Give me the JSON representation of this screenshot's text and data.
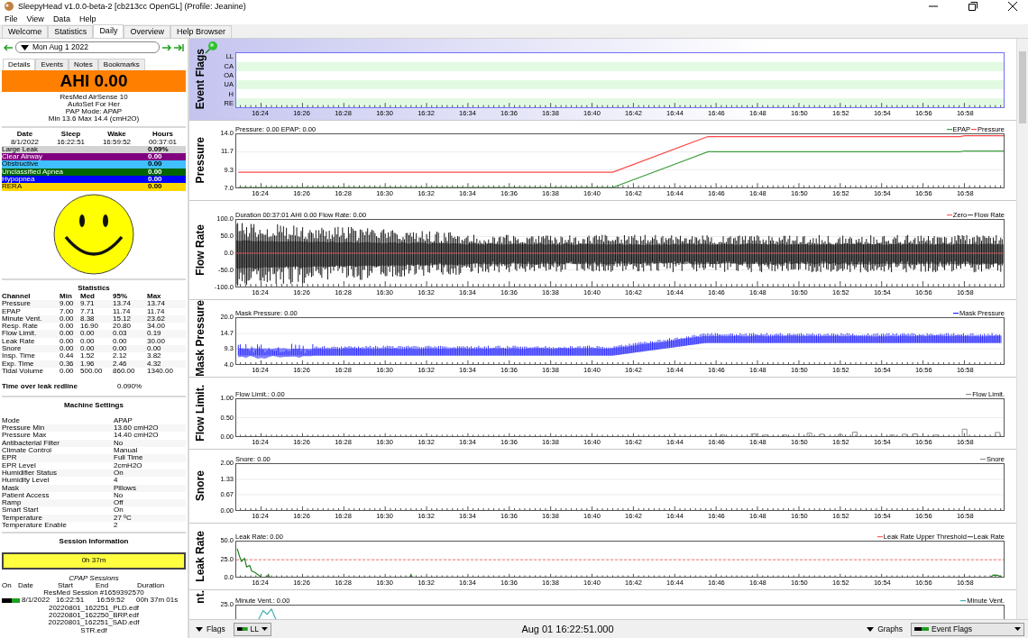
{
  "window": {
    "title": "SleepyHead v1.0.0-beta-2 [cb213cc OpenGL] (Profile: Jeanine)"
  },
  "menu": [
    "File",
    "View",
    "Data",
    "Help"
  ],
  "tabs": [
    {
      "label": "Welcome",
      "selected": false
    },
    {
      "label": "Statistics",
      "selected": false
    },
    {
      "label": "Daily",
      "selected": true
    },
    {
      "label": "Overview",
      "selected": false
    },
    {
      "label": "Help Browser",
      "selected": false
    }
  ],
  "date_nav": {
    "date": "Mon Aug 1 2022"
  },
  "detail_tabs": [
    {
      "label": "Details",
      "selected": true
    },
    {
      "label": "Events",
      "selected": false
    },
    {
      "label": "Notes",
      "selected": false
    },
    {
      "label": "Bookmarks",
      "selected": false
    }
  ],
  "ahi": "AHI 0.00",
  "machine": [
    "ResMed AirSense 10",
    "AutoSet For Her",
    "PAP Mode: APAP",
    "Min 13.6 Max 14.4 (cmH2O)"
  ],
  "times": {
    "headers": [
      "Date",
      "Sleep",
      "Wake",
      "Hours"
    ],
    "values": [
      "8/1/2022",
      "16:22:51",
      "16:59:52",
      "00:37:01"
    ]
  },
  "event_counts": [
    {
      "name": "Large Leak",
      "value": "0.09%",
      "color": "#d3d3d3"
    },
    {
      "name": "Clear Airway",
      "value": "0.00",
      "color": "#800080"
    },
    {
      "name": "Obstructive",
      "value": "0.00",
      "color": "#40c0ff"
    },
    {
      "name": "Unclassified Apnea",
      "value": "0.00",
      "color": "#006400"
    },
    {
      "name": "Hypopnea",
      "value": "0.00",
      "color": "#0000ff"
    },
    {
      "name": "RERA",
      "value": "0.00",
      "color": "#ffd700"
    }
  ],
  "statistics": {
    "title": "Statistics",
    "columns": [
      "Channel",
      "Min",
      "Med",
      "95%",
      "Max"
    ],
    "rows": [
      [
        "Pressure",
        "9.00",
        "9.71",
        "13.74",
        "13.74"
      ],
      [
        "EPAP",
        "7.00",
        "7.71",
        "11.74",
        "11.74"
      ],
      [
        "Minute Vent.",
        "0.00",
        "8.38",
        "15.12",
        "23.62"
      ],
      [
        "Resp. Rate",
        "0.00",
        "16.90",
        "20.80",
        "34.00"
      ],
      [
        "Flow Limit.",
        "0.00",
        "0.00",
        "0.03",
        "0.19"
      ],
      [
        "Leak Rate",
        "0.00",
        "0.00",
        "0.00",
        "30.00"
      ],
      [
        "Snore",
        "0.00",
        "0.00",
        "0.00",
        "0.00"
      ],
      [
        "Insp. Time",
        "0.44",
        "1.52",
        "2.12",
        "3.82"
      ],
      [
        "Exp. Time",
        "0.36",
        "1.96",
        "2.46",
        "4.32"
      ],
      [
        "Tidal Volume",
        "0.00",
        "500.00",
        "860.00",
        "1340.00"
      ]
    ]
  },
  "leak_redline": {
    "label": "Time over leak redline",
    "value": "0.090%"
  },
  "machine_settings": {
    "title": "Machine Settings",
    "rows": [
      [
        "Mode",
        "APAP"
      ],
      [
        "Pressure Min",
        "13.60 cmH2O"
      ],
      [
        "Pressure Max",
        "14.40 cmH2O"
      ],
      [
        "Antibacterial Filter",
        "No"
      ],
      [
        "Climate Control",
        "Manual"
      ],
      [
        "EPR",
        "Full Time"
      ],
      [
        "EPR Level",
        "2cmH2O"
      ],
      [
        "Humidifier Status",
        "On"
      ],
      [
        "Humidity Level",
        "4"
      ],
      [
        "Mask",
        "Pillows"
      ],
      [
        "Patient Access",
        "No"
      ],
      [
        "Ramp",
        "Off"
      ],
      [
        "Smart Start",
        "On"
      ],
      [
        "Temperature",
        "27 ºC"
      ],
      [
        "Temperature Enable",
        "2"
      ]
    ]
  },
  "session_info": {
    "title": "Session Information",
    "duration": "0h 37m"
  },
  "cpap_sessions": {
    "title": "CPAP Sessions",
    "columns": [
      "On",
      "Date",
      "Start",
      "End",
      "Duration"
    ],
    "session": "ResMed Session #1659392570",
    "row": [
      "8/1/2022",
      "16:22:51",
      "16:59:52",
      "00h 37m 01s"
    ],
    "files": [
      "20220801_162251_PLD.edf",
      "20220801_162250_BRP.edf",
      "20220801_162251_SAD.edf",
      "STR.edf"
    ]
  },
  "graphs": [
    {
      "kind": "flags",
      "title": "Event Flags",
      "rows": [
        "LL",
        "CA",
        "OA",
        "UA",
        "H",
        "RE"
      ],
      "x_labels": [
        "16:24",
        "16:26",
        "16:28",
        "16:30",
        "16:32",
        "16:34",
        "16:36",
        "16:38",
        "16:40",
        "16:42",
        "16:44",
        "16:46",
        "16:48",
        "16:50",
        "16:52",
        "16:54",
        "16:56",
        "16:58"
      ]
    },
    {
      "kind": "line",
      "title": "Pressure",
      "readout": "Pressure: 0.00 EPAP: 0.00",
      "chart_data": {
        "type": "line",
        "x": [
          982.9,
          1001.0,
          1005.6,
          1017.8,
          1018.0,
          1019.9
        ],
        "series": [
          {
            "name": "EPAP",
            "color": "#40a040",
            "values": [
              7.0,
              7.0,
              11.7,
              11.7,
              11.8,
              11.8
            ]
          },
          {
            "name": "Pressure",
            "color": "#ff4848",
            "values": [
              9.0,
              9.0,
              13.7,
              13.7,
              13.8,
              13.8
            ]
          }
        ],
        "legend": "top-right",
        "xlim": [
          982.8,
          1019.9
        ],
        "ylim": [
          7,
          14
        ],
        "xticks": [
          {
            "value": 984,
            "label": "16:24"
          },
          {
            "value": 986,
            "label": "16:26"
          },
          {
            "value": 988,
            "label": "16:28"
          },
          {
            "value": 990,
            "label": "16:30"
          },
          {
            "value": 992,
            "label": "16:32"
          },
          {
            "value": 994,
            "label": "16:34"
          },
          {
            "value": 996,
            "label": "16:36"
          },
          {
            "value": 998,
            "label": "16:38"
          },
          {
            "value": 1000,
            "label": "16:40"
          },
          {
            "value": 1002,
            "label": "16:42"
          },
          {
            "value": 1004,
            "label": "16:44"
          },
          {
            "value": 1006,
            "label": "16:46"
          },
          {
            "value": 1008,
            "label": "16:48"
          },
          {
            "value": 1010,
            "label": "16:50"
          },
          {
            "value": 1012,
            "label": "16:52"
          },
          {
            "value": 1014,
            "label": "16:54"
          },
          {
            "value": 1016,
            "label": "16:56"
          },
          {
            "value": 1018,
            "label": "16:58"
          }
        ],
        "yticks": [
          {
            "value": 14,
            "label": "14.0"
          },
          {
            "value": 11.67,
            "label": "11.7"
          },
          {
            "value": 9.33,
            "label": "9.3"
          },
          {
            "value": 7,
            "label": "7.0"
          }
        ]
      }
    },
    {
      "kind": "flow",
      "title": "Flow Rate",
      "readout": "Duration 00:37:01 AHI 0.00 Flow Rate: 0.00",
      "legend": [
        {
          "label": "Zero",
          "color": "#ff6060"
        },
        {
          "label": "Flow Rate",
          "color": "#606060"
        }
      ],
      "y_labels": [
        "100.0",
        "50.0",
        "0.0",
        "-50.0",
        "-100.0"
      ],
      "x_labels": [
        "16:24",
        "16:26",
        "16:28",
        "16:30",
        "16:32",
        "16:34",
        "16:36",
        "16:38",
        "16:40",
        "16:42",
        "16:44",
        "16:46",
        "16:48",
        "16:50",
        "16:52",
        "16:54",
        "16:56",
        "16:58"
      ]
    },
    {
      "kind": "mask",
      "title": "Mask Pressure",
      "readout": "Mask Pressure: 0.00",
      "legend": [
        {
          "label": "Mask Pressure",
          "color": "#2020ff"
        }
      ],
      "y_labels": [
        "20.0",
        "14.7",
        "9.3",
        "4.0"
      ],
      "x_labels": [
        "16:24",
        "16:26",
        "16:28",
        "16:30",
        "16:32",
        "16:34",
        "16:36",
        "16:38",
        "16:40",
        "16:42",
        "16:44",
        "16:46",
        "16:48",
        "16:50",
        "16:52",
        "16:54",
        "16:56",
        "16:58"
      ]
    },
    {
      "kind": "limit",
      "title": "Flow Limit.",
      "readout": "Flow Limit.: 0.00",
      "legend": [
        {
          "label": "Flow Limit.",
          "color": "#909090"
        }
      ],
      "y_labels": [
        "1.00",
        "0.50",
        "0.00"
      ],
      "x_labels": [
        "16:24",
        "16:26",
        "16:28",
        "16:30",
        "16:32",
        "16:34",
        "16:36",
        "16:38",
        "16:40",
        "16:42",
        "16:44",
        "16:46",
        "16:48",
        "16:50",
        "16:52",
        "16:54",
        "16:56",
        "16:58"
      ]
    },
    {
      "kind": "snore",
      "title": "Snore",
      "readout": "Snore: 0.00",
      "legend": [
        {
          "label": "Snore",
          "color": "#909090"
        }
      ],
      "y_labels": [
        "2.00",
        "1.33",
        "0.67",
        "0.00"
      ],
      "x_labels": [
        "16:24",
        "16:26",
        "16:28",
        "16:30",
        "16:32",
        "16:34",
        "16:36",
        "16:38",
        "16:40",
        "16:42",
        "16:44",
        "16:46",
        "16:48",
        "16:50",
        "16:52",
        "16:54",
        "16:56",
        "16:58"
      ]
    },
    {
      "kind": "leak",
      "title": "Leak Rate",
      "readout": "Leak Rate: 0.00",
      "legend": [
        {
          "label": "Leak Rate Upper Threshold",
          "color": "#ff6060"
        },
        {
          "label": "Leak Rate",
          "color": "#606060"
        }
      ],
      "y_labels": [
        "50.0",
        "25.0",
        "0.0"
      ],
      "x_labels": [
        "16:24",
        "16:26",
        "16:28",
        "16:30",
        "16:32",
        "16:34",
        "16:36",
        "16:38",
        "16:40",
        "16:42",
        "16:44",
        "16:46",
        "16:48",
        "16:50",
        "16:52",
        "16:54",
        "16:56",
        "16:58"
      ]
    },
    {
      "kind": "vent",
      "title": "nt.",
      "readout": "Minute Vent.: 0.00",
      "legend": [
        {
          "label": "Minute Vent.",
          "color": "#40b0b0"
        }
      ],
      "y_labels": [
        "25.0"
      ]
    }
  ],
  "bottom_bar": {
    "flags_label": "Flags",
    "flags_combo": "LL",
    "time": "Aug 01 16:22:51.000",
    "graphs_label": "Graphs",
    "graphs_combo": "Event Flags"
  }
}
